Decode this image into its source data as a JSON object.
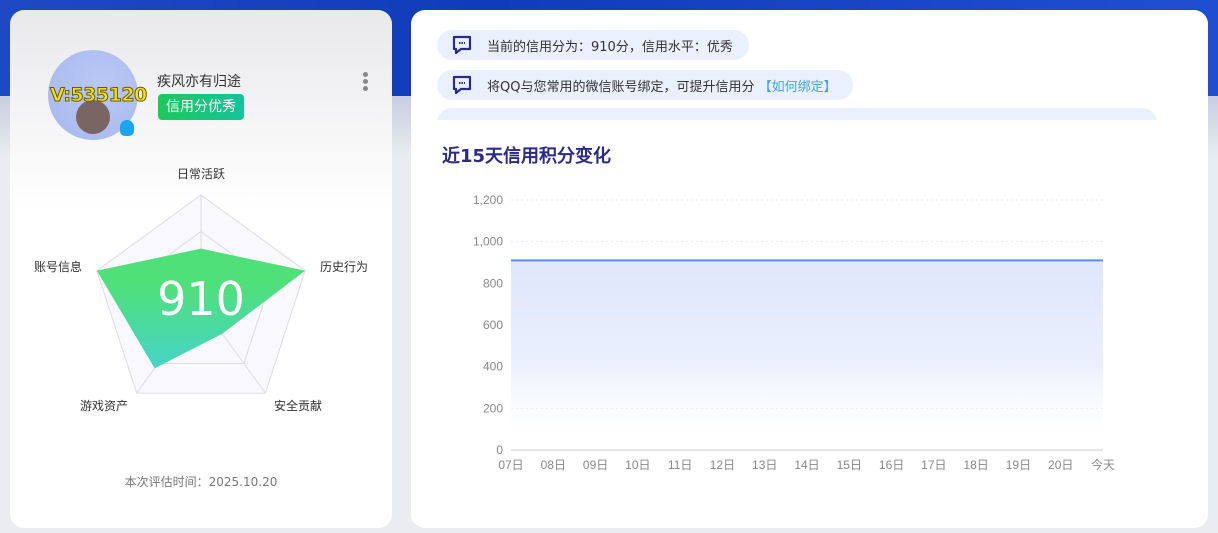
{
  "profile": {
    "nickname": "疾风亦有归途",
    "avatar_text": "V:535120",
    "badge": "信用分优秀",
    "more_icon": "more-vertical-icon"
  },
  "radar": {
    "score": "910",
    "axes": [
      {
        "label": "日常活跃",
        "value": 0.51
      },
      {
        "label": "历史行为",
        "value": 1.0
      },
      {
        "label": "安全贡献",
        "value": 0.33
      },
      {
        "label": "游戏资产",
        "value": 0.72
      },
      {
        "label": "账号信息",
        "value": 1.0
      }
    ],
    "fill_colors": [
      "#4fe07a",
      "#46d4c8"
    ]
  },
  "eval_time": "本次评估时间：2025.10.20",
  "messages": [
    {
      "text": "当前的信用分为：910分，信用水平：优秀"
    },
    {
      "text": "将QQ与您常用的微信账号绑定，可提升信用分",
      "link": "【如何绑定】"
    }
  ],
  "chart_data": {
    "type": "area",
    "title": "近15天信用积分变化",
    "categories": [
      "07日",
      "08日",
      "09日",
      "10日",
      "11日",
      "12日",
      "13日",
      "14日",
      "15日",
      "16日",
      "17日",
      "18日",
      "19日",
      "20日",
      "今天"
    ],
    "values": [
      910,
      910,
      910,
      910,
      910,
      910,
      910,
      910,
      910,
      910,
      910,
      910,
      910,
      910,
      910
    ],
    "ylim": [
      0,
      1200
    ],
    "yticks": [
      0,
      200,
      400,
      600,
      800,
      1000,
      1200
    ],
    "ytick_labels": [
      "0",
      "200",
      "400",
      "600",
      "800",
      "1,000",
      "1,200"
    ],
    "grid": true,
    "line_color": "#5b8ff0"
  }
}
